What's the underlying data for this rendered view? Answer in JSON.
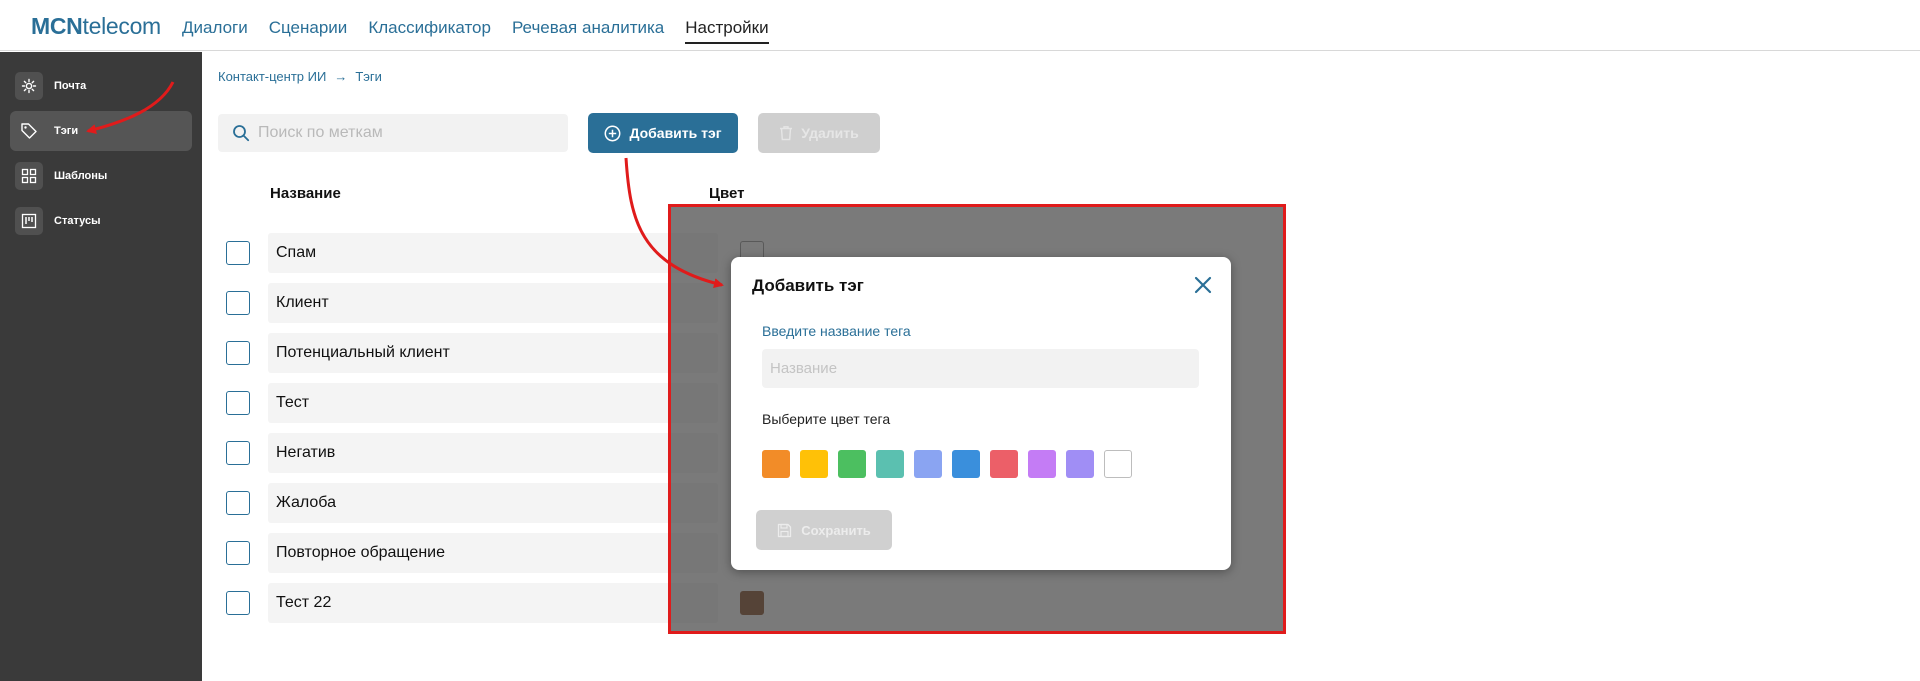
{
  "header": {
    "logo_bold": "MCN",
    "logo_rest": "telecom",
    "nav": [
      {
        "label": "Диалоги"
      },
      {
        "label": "Сценарии"
      },
      {
        "label": "Классификатор"
      },
      {
        "label": "Речевая аналитика"
      },
      {
        "label": "Настройки",
        "active": true
      }
    ]
  },
  "sidebar": {
    "items": [
      {
        "label": "Почта",
        "icon": "gear-icon"
      },
      {
        "label": "Тэги",
        "icon": "tag-icon",
        "active": true
      },
      {
        "label": "Шаблоны",
        "icon": "grid-icon"
      },
      {
        "label": "Статусы",
        "icon": "kanban-icon"
      }
    ]
  },
  "breadcrumb": {
    "parent": "Контакт-центр ИИ",
    "separator": "→",
    "current": "Тэги"
  },
  "toolbar": {
    "search_placeholder": "Поиск по меткам",
    "add_label": "Добавить тэг",
    "delete_label": "Удалить"
  },
  "table": {
    "headers": {
      "name": "Название",
      "color": "Цвет"
    },
    "rows": [
      {
        "name": "Спам",
        "color": "#ffffff"
      },
      {
        "name": "Клиент",
        "color": ""
      },
      {
        "name": "Потенциальный клиент",
        "color": ""
      },
      {
        "name": "Тест",
        "color": ""
      },
      {
        "name": "Негатив",
        "color": ""
      },
      {
        "name": "Жалоба",
        "color": ""
      },
      {
        "name": "Повторное обращение",
        "color": ""
      },
      {
        "name": "Тест 22",
        "color": "#7a3b10"
      }
    ]
  },
  "modal": {
    "title": "Добавить тэг",
    "name_label": "Введите название тега",
    "name_placeholder": "Название",
    "color_label": "Выберите цвет тега",
    "colors": [
      "#f28c28",
      "#ffc107",
      "#4cbf60",
      "#5bc0b0",
      "#8aa4f2",
      "#3a8fdc",
      "#ec5f68",
      "#c47cf5",
      "#a08ef5",
      "#ffffff"
    ],
    "save_label": "Сохранить"
  },
  "accent_color": "#2a6f97",
  "highlight_color": "#e01b1b"
}
